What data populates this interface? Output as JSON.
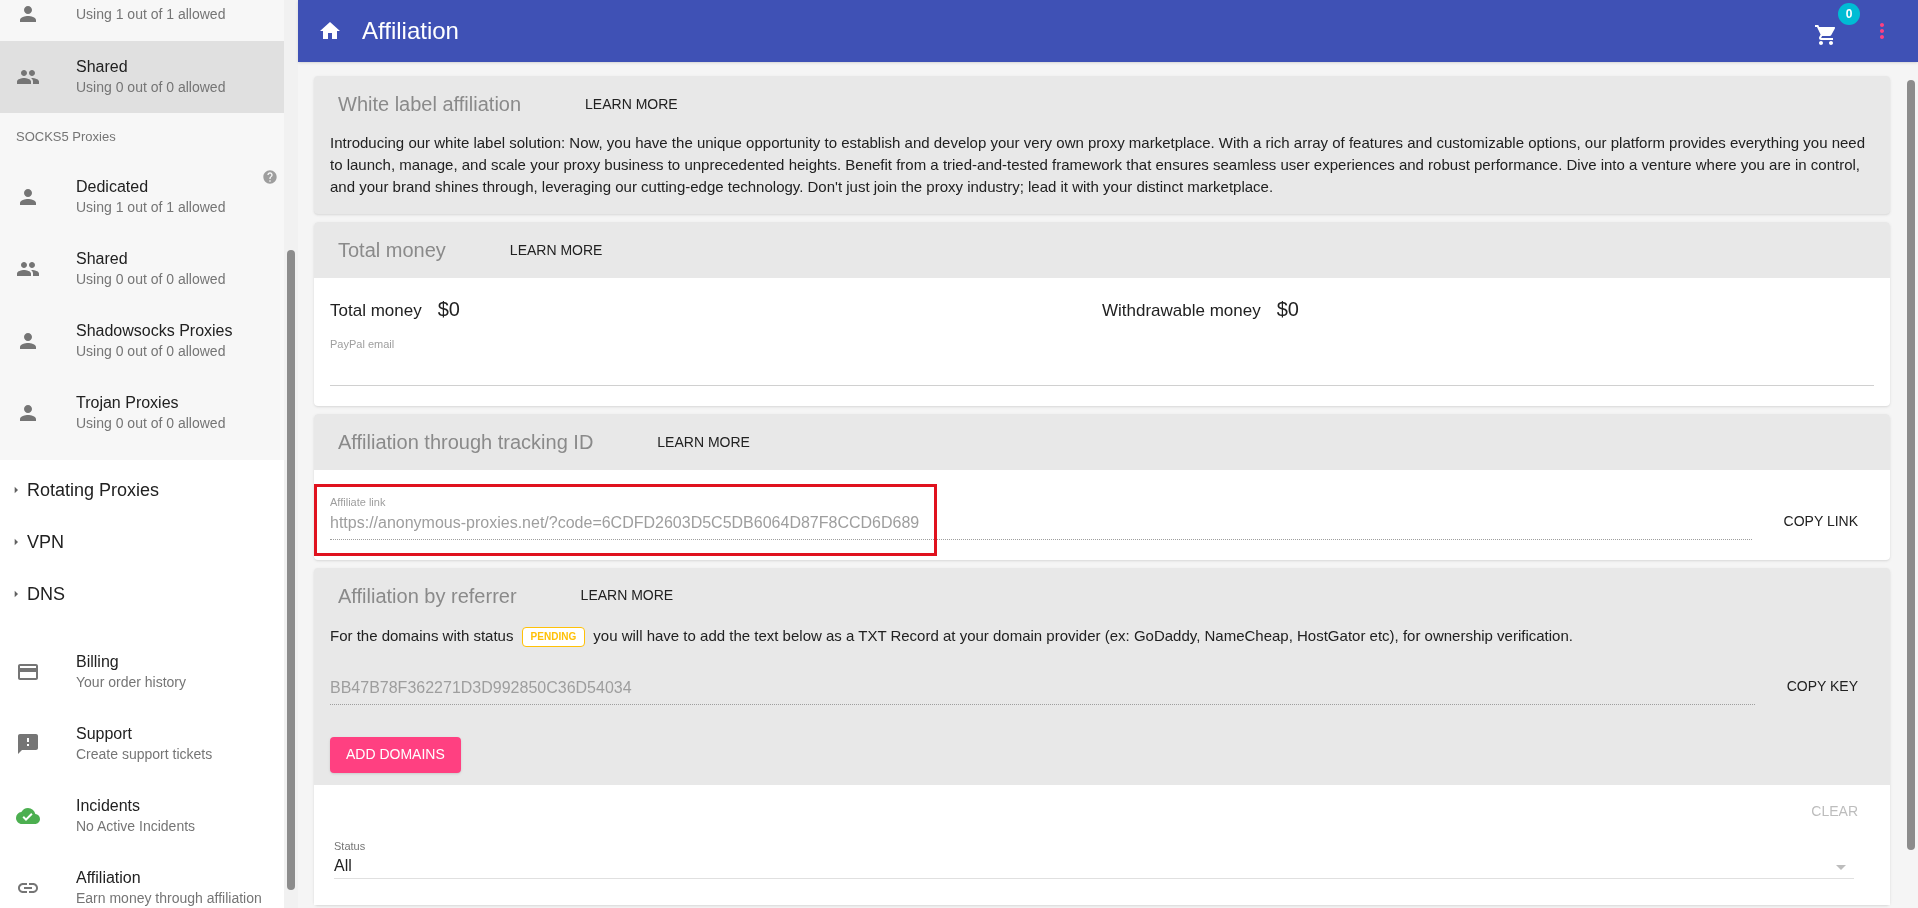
{
  "header": {
    "title": "Affiliation",
    "cart_count": "0"
  },
  "sidebar": {
    "partial_item": {
      "kind": "person",
      "subtitle": "Using 1 out of 1 allowed"
    },
    "proxy_items": [
      {
        "kind": "people",
        "title": "Shared",
        "subtitle": "Using 0 out of 0 allowed",
        "selected": true
      }
    ],
    "socks5": {
      "heading": "SOCKS5 Proxies",
      "items": [
        {
          "kind": "person",
          "title": "Dedicated",
          "subtitle": "Using 1 out of 1 allowed",
          "selected": false,
          "help": true
        },
        {
          "kind": "people",
          "title": "Shared",
          "subtitle": "Using 0 out of 0 allowed",
          "selected": false,
          "help": false
        },
        {
          "kind": "person",
          "title": "Shadowsocks Proxies",
          "subtitle": "Using 0 out of 0 allowed",
          "selected": false,
          "help": false
        },
        {
          "kind": "person",
          "title": "Trojan Proxies",
          "subtitle": "Using 0 out of 0 allowed",
          "selected": false,
          "help": false
        }
      ]
    },
    "groups": [
      {
        "label": "Rotating Proxies",
        "expanded": false
      },
      {
        "label": "VPN",
        "expanded": false
      },
      {
        "label": "DNS",
        "expanded": false
      }
    ],
    "links": [
      {
        "kind": "billing",
        "title": "Billing",
        "subtitle": "Your order history"
      },
      {
        "kind": "support",
        "title": "Support",
        "subtitle": "Create support tickets"
      },
      {
        "kind": "incidents",
        "title": "Incidents",
        "subtitle": "No Active Incidents"
      },
      {
        "kind": "affiliation",
        "title": "Affiliation",
        "subtitle": "Earn money through affiliation"
      }
    ]
  },
  "cards": [
    {
      "kind": "text",
      "title": "White label affiliation",
      "action": "LEARN MORE",
      "body": "Introducing our white label solution: Now, you have the unique opportunity to establish and develop your very own proxy marketplace. With a rich array of features and customizable options, our platform provides everything you need to launch, manage, and scale your proxy business to unprecedented heights. Benefit from a tried-and-tested framework that ensures seamless user experiences and robust performance. Dive into a venture where you are in control, and your brand shines through, leveraging our cutting-edge technology. Don't just join the proxy industry; lead it with your distinct marketplace."
    },
    {
      "kind": "money",
      "title": "Total money",
      "action": "LEARN MORE",
      "stats": [
        {
          "label": "Total money",
          "value": "$0"
        },
        {
          "label": "Withdrawable money",
          "value": "$0"
        }
      ],
      "field": {
        "label": "PayPal email"
      }
    },
    {
      "kind": "link",
      "title": "Affiliation through tracking ID",
      "action": "LEARN MORE",
      "field": {
        "label": "Affiliate link",
        "value": "https://anonymous-proxies.net/?code=6CDFD2603D5C5DB6064D87F8CCD6D689"
      },
      "button": "COPY LINK",
      "highlighted": true
    },
    {
      "kind": "referrer",
      "title": "Affiliation by referrer",
      "action": "LEARN MORE",
      "note_before": "For the domains with status",
      "badge": "PENDING",
      "note_after": "you will have to add the text below as a TXT Record at your domain provider (ex: GoDaddy, NameCheap, HostGator etc), for ownership verification.",
      "key": "BB47B78F362271D3D992850C36D54034",
      "key_button": "COPY KEY",
      "add_button": "ADD DOMAINS",
      "clear_button": "CLEAR",
      "filter": {
        "label": "Status",
        "value": "All"
      }
    }
  ]
}
